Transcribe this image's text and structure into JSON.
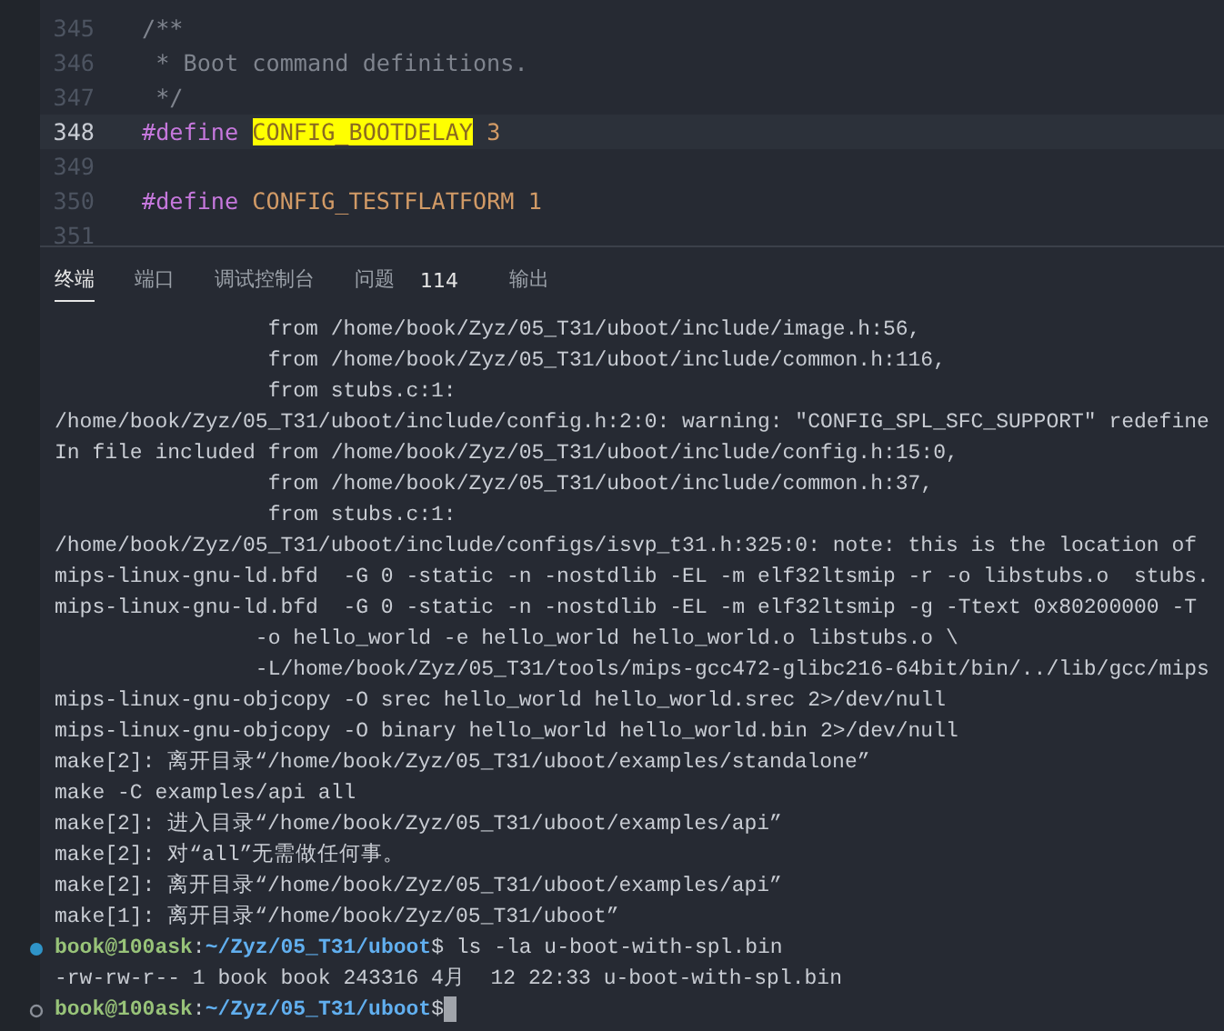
{
  "editor": {
    "lines": [
      {
        "number": "345",
        "selected": false,
        "parts": [
          {
            "kind": "comment",
            "text": "/**"
          }
        ]
      },
      {
        "number": "346",
        "selected": false,
        "parts": [
          {
            "kind": "comment",
            "text": " * Boot command definitions."
          }
        ]
      },
      {
        "number": "347",
        "selected": false,
        "parts": [
          {
            "kind": "comment",
            "text": " */"
          }
        ]
      },
      {
        "number": "348",
        "selected": true,
        "parts": [
          {
            "kind": "keyword",
            "text": "#define "
          },
          {
            "kind": "highlight",
            "text": "CONFIG_BOOTDELAY"
          },
          {
            "kind": "number",
            "text": " 3"
          }
        ]
      },
      {
        "number": "349",
        "selected": false
      },
      {
        "number": "350",
        "selected": false,
        "parts": [
          {
            "kind": "keyword",
            "text": "#define "
          },
          {
            "kind": "macro",
            "text": "CONFIG_TESTFLATFORM"
          },
          {
            "kind": "number",
            "text": " 1"
          }
        ]
      },
      {
        "number": "351",
        "selected": false
      }
    ]
  },
  "panel_tabs": [
    {
      "label": "终端",
      "selected": true
    },
    {
      "label": "端口",
      "selected": false
    },
    {
      "label": "调试控制台",
      "selected": false
    },
    {
      "label": "问题",
      "selected": false,
      "badge": "114"
    },
    {
      "label": "输出",
      "selected": false
    }
  ],
  "terminal": {
    "lines": [
      {
        "kind": "output",
        "text": "                 from /home/book/Zyz/05_T31/uboot/include/image.h:56,"
      },
      {
        "kind": "output",
        "text": "                 from /home/book/Zyz/05_T31/uboot/include/common.h:116,"
      },
      {
        "kind": "output",
        "text": "                 from stubs.c:1:"
      },
      {
        "kind": "output",
        "text": "/home/book/Zyz/05_T31/uboot/include/config.h:2:0: warning: \"CONFIG_SPL_SFC_SUPPORT\" redefine"
      },
      {
        "kind": "output",
        "text": "In file included from /home/book/Zyz/05_T31/uboot/include/config.h:15:0,"
      },
      {
        "kind": "output",
        "text": "                 from /home/book/Zyz/05_T31/uboot/include/common.h:37,"
      },
      {
        "kind": "output",
        "text": "                 from stubs.c:1:"
      },
      {
        "kind": "output",
        "text": "/home/book/Zyz/05_T31/uboot/include/configs/isvp_t31.h:325:0: note: this is the location of"
      },
      {
        "kind": "output",
        "text": "mips-linux-gnu-ld.bfd  -G 0 -static -n -nostdlib -EL -m elf32ltsmip -r -o libstubs.o  stubs."
      },
      {
        "kind": "output",
        "text": "mips-linux-gnu-ld.bfd  -G 0 -static -n -nostdlib -EL -m elf32ltsmip -g -Ttext 0x80200000 -T"
      },
      {
        "kind": "output",
        "text": "                -o hello_world -e hello_world hello_world.o libstubs.o \\"
      },
      {
        "kind": "output",
        "text": "                -L/home/book/Zyz/05_T31/tools/mips-gcc472-glibc216-64bit/bin/../lib/gcc/mips"
      },
      {
        "kind": "output",
        "text": "mips-linux-gnu-objcopy -O srec hello_world hello_world.srec 2>/dev/null"
      },
      {
        "kind": "output",
        "text": "mips-linux-gnu-objcopy -O binary hello_world hello_world.bin 2>/dev/null"
      },
      {
        "kind": "output",
        "text": "make[2]: 离开目录“/home/book/Zyz/05_T31/uboot/examples/standalone”"
      },
      {
        "kind": "output",
        "text": "make -C examples/api all"
      },
      {
        "kind": "output",
        "text": "make[2]: 进入目录“/home/book/Zyz/05_T31/uboot/examples/api”"
      },
      {
        "kind": "output",
        "text": "make[2]: 对“all”无需做任何事。"
      },
      {
        "kind": "output",
        "text": "make[2]: 离开目录“/home/book/Zyz/05_T31/uboot/examples/api”"
      },
      {
        "kind": "output",
        "text": "make[1]: 离开目录“/home/book/Zyz/05_T31/uboot”"
      },
      {
        "kind": "prompt",
        "done": true,
        "user": "book@100ask",
        "separator": ":",
        "path": "~/Zyz/05_T31/uboot",
        "symbol": "$",
        "command": " ls -la u-boot-with-spl.bin"
      },
      {
        "kind": "output",
        "text": "-rw-rw-r-- 1 book book 243316 4月  12 22:33 u-boot-with-spl.bin"
      },
      {
        "kind": "prompt",
        "done": false,
        "user": "book@100ask",
        "separator": ":",
        "path": "~/Zyz/05_T31/uboot",
        "symbol": "$"
      }
    ]
  }
}
